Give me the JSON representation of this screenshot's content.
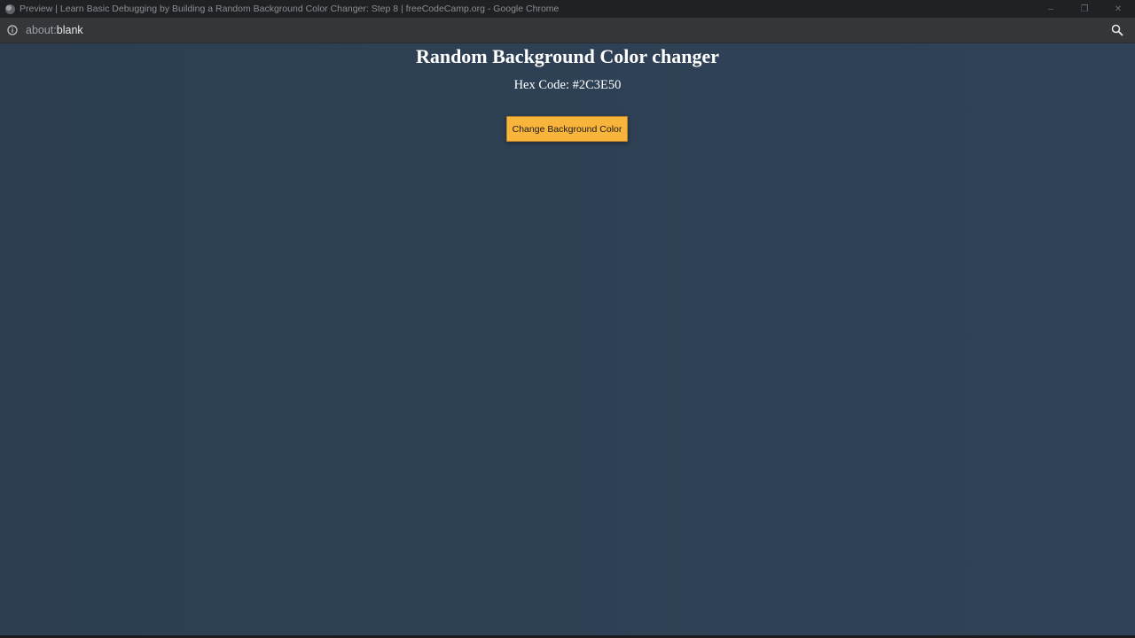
{
  "window": {
    "title": "Preview | Learn Basic Debugging by Building a Random Background Color Changer: Step 8 | freeCodeCamp.org - Google Chrome",
    "controls": {
      "minimize": "–",
      "restore": "❐",
      "close": "✕"
    }
  },
  "addressbar": {
    "url_scheme": "about:",
    "url_path": "blank"
  },
  "page": {
    "heading": "Random Background Color changer",
    "hex_label": "Hex Code: ",
    "hex_value": "#2C3E50",
    "button_label": "Change Background Color"
  },
  "colors": {
    "page_background": "#2C3E50",
    "button_background": "#F9B43C",
    "text": "#FFFFFF"
  }
}
